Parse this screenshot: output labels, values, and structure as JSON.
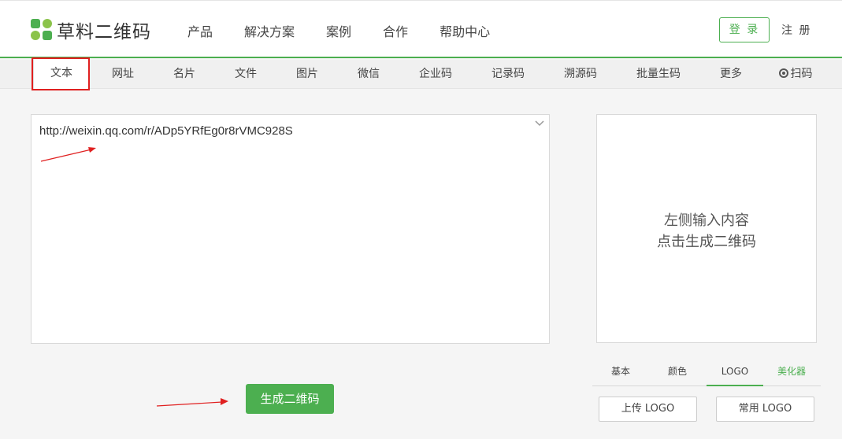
{
  "header": {
    "logo_text": "草料二维码",
    "nav": [
      "产品",
      "解决方案",
      "案例",
      "合作",
      "帮助中心"
    ],
    "login": "登 录",
    "register": "注 册"
  },
  "tabs": [
    "文本",
    "网址",
    "名片",
    "文件",
    "图片",
    "微信",
    "企业码",
    "记录码",
    "溯源码",
    "批量生码",
    "更多",
    "扫码"
  ],
  "editor": {
    "value": "http://weixin.qq.com/r/ADp5YRfEg0r8rVMC928S"
  },
  "preview": {
    "line1": "左侧输入内容",
    "line2": "点击生成二维码"
  },
  "generate_button": "生成二维码",
  "options": {
    "tabs": [
      "基本",
      "颜色",
      "LOGO",
      "美化器"
    ],
    "upload_logo": "上传 LOGO",
    "common_logo": "常用 LOGO"
  },
  "colors": {
    "brand_green": "#4caf50",
    "annotation_red": "#e02020"
  }
}
